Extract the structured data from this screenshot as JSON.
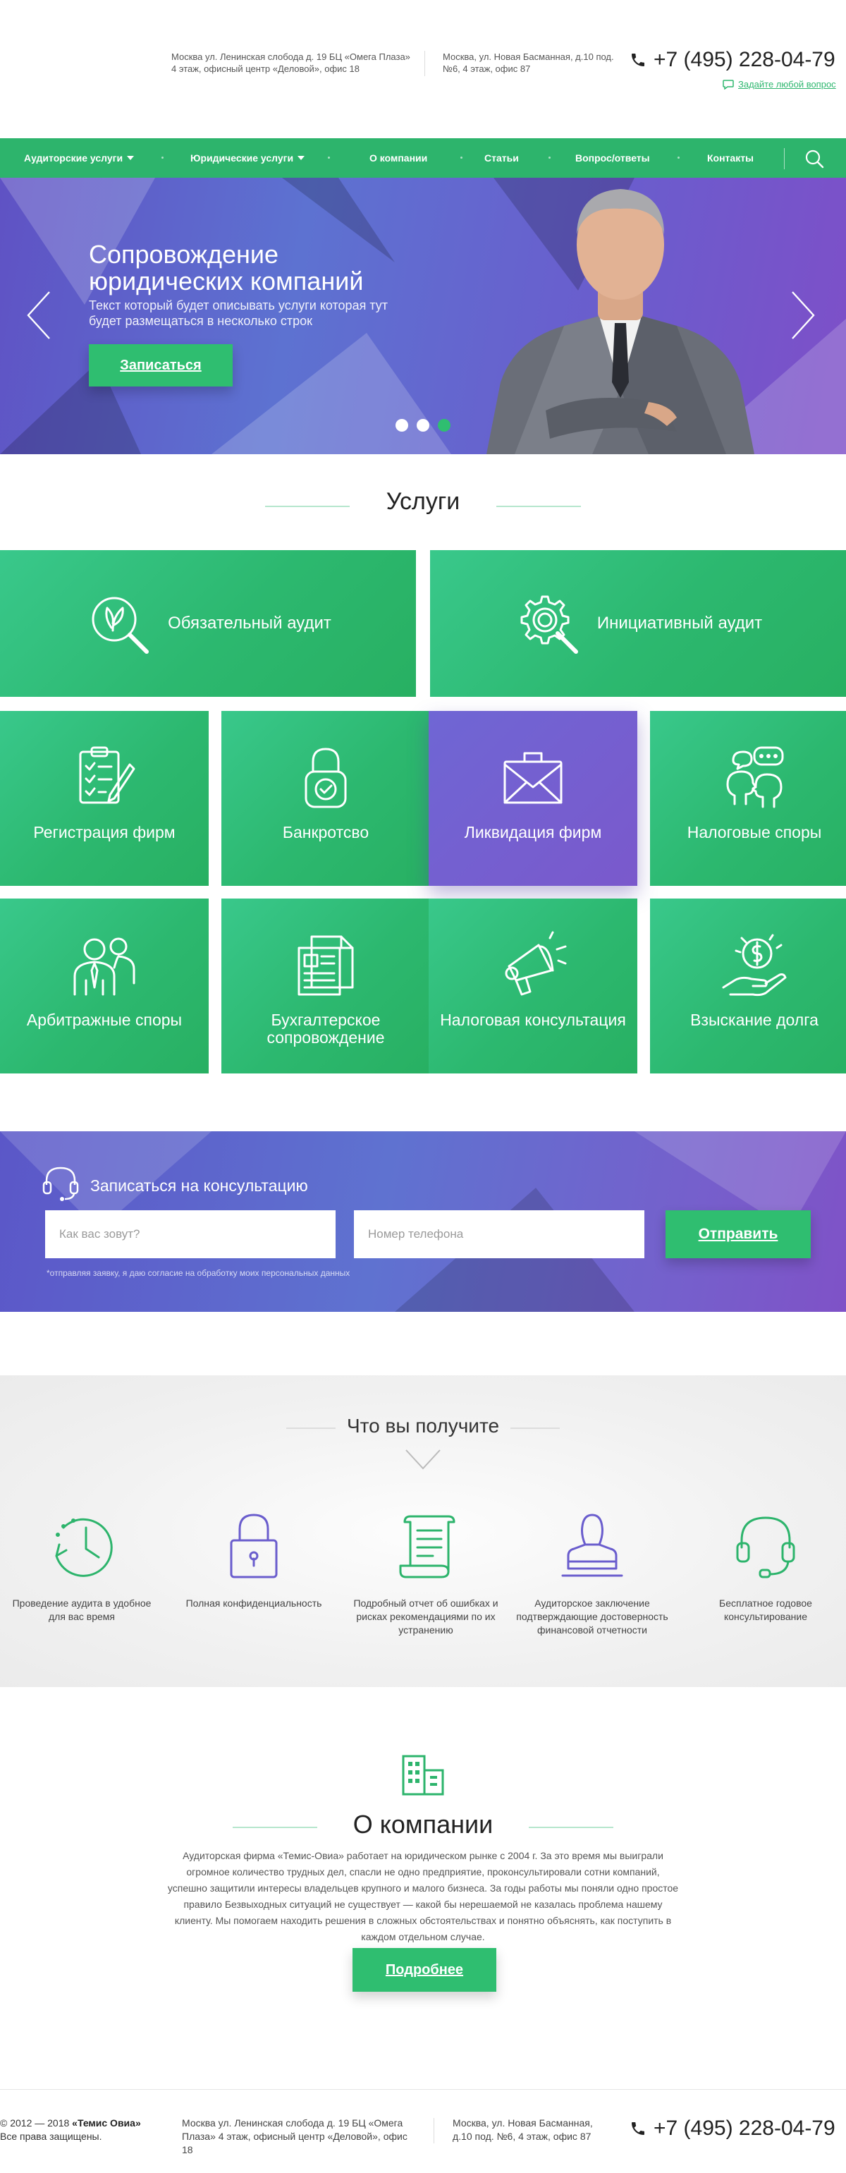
{
  "header": {
    "address1": "Москва ул. Ленинская слобода д. 19 БЦ «Омега Плаза» 4 этаж, офисный центр «Деловой», офис 18",
    "address2": "Москва, ул. Новая Басманная, д.10 под. №6, 4 этаж, офис 87",
    "phone": "+7 (495) 228-04-79",
    "ask_link": "Задайте любой вопрос",
    "icons": [
      "phone-icon",
      "chat-icon"
    ]
  },
  "nav": {
    "items": [
      {
        "label": "Аудиторские услуги",
        "dropdown": true
      },
      {
        "label": "Юридические услуги",
        "dropdown": true
      },
      {
        "label": "О компании",
        "dropdown": false
      },
      {
        "label": "Статьи",
        "dropdown": false
      },
      {
        "label": "Вопрос/ответы",
        "dropdown": false
      },
      {
        "label": "Контакты",
        "dropdown": false
      }
    ],
    "search_icon": "search-icon"
  },
  "hero": {
    "title": "Сопровождение юридических компаний",
    "subtitle": "Текст который будет описывать услуги которая тут будет размещаться в несколько строк",
    "button": "Записаться",
    "slides": 3,
    "active_slide": 3
  },
  "services": {
    "title": "Услуги",
    "wide": [
      {
        "label": "Обязательный аудит",
        "icon": "magnifier-leaf-icon"
      },
      {
        "label": "Инициативный аудит",
        "icon": "gear-magnifier-icon"
      }
    ],
    "tiles": [
      {
        "label": "Регистрация фирм",
        "icon": "checklist-pen-icon"
      },
      {
        "label": "Банкротсво",
        "icon": "padlock-icon"
      },
      {
        "label": "Ликвидация фирм",
        "icon": "briefcase-icon",
        "highlighted": true
      },
      {
        "label": "Налоговые споры",
        "icon": "dialog-heads-icon"
      },
      {
        "label": "Арбитражные споры",
        "icon": "businessmen-icon"
      },
      {
        "label": "Бухгалтерское сопровождение",
        "icon": "documents-icon"
      },
      {
        "label": "Налоговая консультация",
        "icon": "megaphone-icon"
      },
      {
        "label": "Взыскание долга",
        "icon": "money-hand-icon"
      }
    ]
  },
  "consult": {
    "title": "Записаться на консультацию",
    "name_placeholder": "Как вас зовут?",
    "phone_placeholder": "Номер телефона",
    "button": "Отправить",
    "note": "*отправляя заявку, я даю согласие на обработку моих персональных данных"
  },
  "benefits": {
    "title": "Что вы получите",
    "items": [
      {
        "text": "Проведение аудита в удобное для вас время",
        "icon": "clock-icon",
        "color": "#2db46c"
      },
      {
        "text": "Полная конфиденциальность",
        "icon": "lock-icon",
        "color": "#6a5dcd"
      },
      {
        "text": "Подробный отчет об ошибках и рисках рекомендациями по их устранению",
        "icon": "scroll-icon",
        "color": "#2db46c"
      },
      {
        "text": "Аудиторское заключение подтверждающие достоверность финансовой отчетности",
        "icon": "stamp-icon",
        "color": "#6a5dcd"
      },
      {
        "text": "Бесплатное годовое консультирование",
        "icon": "headset-icon",
        "color": "#2db46c"
      }
    ]
  },
  "about": {
    "title": "О компании",
    "text": "Аудиторская фирма «Темис-Овиа» работает на юридическом рынке с 2004 г. За это время мы выиграли огромное количество трудных дел, спасли не одно предприятие, проконсультировали сотни компаний, успешно защитили интересы владельцев крупного и малого бизнеса. За годы работы мы поняли одно простое правило  Безвыходных ситуаций не существует — какой бы нерешаемой не казалась проблема нашему клиенту. Мы помогаем находить решения в сложных обстоятельствах и понятно объяснять, как поступить в каждом отдельном случае.",
    "button": "Подробнее"
  },
  "footer": {
    "copyright_prefix": "© 2012 — 2018",
    "company": "«Темис Овиа»",
    "rights": "Все права защищены.",
    "address1": "Москва ул. Ленинская слобода д. 19 БЦ «Омега Плаза» 4 этаж, офисный центр «Деловой», офис 18",
    "address2": "Москва, ул. Новая Басманная, д.10 под. №6, 4 этаж, офис 87",
    "phone": "+7 (495) 228-04-79"
  },
  "colors": {
    "green": "#2db46c",
    "purple": "#6a5dcd",
    "text": "#333333"
  }
}
